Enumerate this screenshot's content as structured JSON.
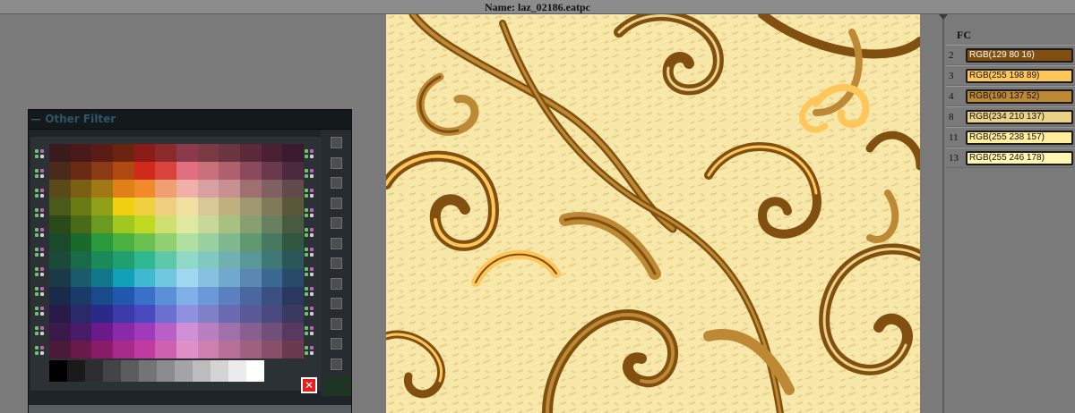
{
  "window": {
    "title": "Name: laz_02186.eatpc"
  },
  "fc_panel": {
    "title": "FC",
    "rows": [
      {
        "index": "2",
        "label": "RGB(129 80 16)",
        "color": "#815010",
        "text_color": "#ffffff"
      },
      {
        "index": "3",
        "label": "RGB(255 198 89)",
        "color": "#ffc659",
        "text_color": "#111111"
      },
      {
        "index": "4",
        "label": "RGB(190 137 52)",
        "color": "#be8934",
        "text_color": "#111111"
      },
      {
        "index": "8",
        "label": "RGB(234 210 137)",
        "color": "#ead289",
        "text_color": "#111111"
      },
      {
        "index": "11",
        "label": "RGB(255 238 157)",
        "color": "#ffee9d",
        "text_color": "#111111"
      },
      {
        "index": "13",
        "label": "RGB(255 246 178)",
        "color": "#fff6b2",
        "text_color": "#111111"
      }
    ]
  },
  "filter_panel": {
    "title": "Other Filter",
    "close_icon": "close-x-icon",
    "palette": [
      [
        "#3a1a1c",
        "#4a1a1a",
        "#5a1c14",
        "#6a2410",
        "#8a1c18",
        "#8a2a2a",
        "#8a3a4a",
        "#7a3a44",
        "#6a3440",
        "#5a2a3a",
        "#4a2034",
        "#3a1a2c"
      ],
      [
        "#4a2a1a",
        "#6a2a14",
        "#8a3a14",
        "#b04a10",
        "#d02a1a",
        "#d8443c",
        "#e07080",
        "#c8707c",
        "#b0606c",
        "#8a4a5c",
        "#6a3a4c",
        "#4a2a3c"
      ],
      [
        "#5a4a1a",
        "#7a6014",
        "#a07814",
        "#e08018",
        "#f08a2a",
        "#f0a070",
        "#f0b0a8",
        "#d8a0a0",
        "#c89090",
        "#a07070",
        "#806060",
        "#604a4a"
      ],
      [
        "#4a5a1a",
        "#6a7a14",
        "#90a018",
        "#f0d010",
        "#f0d040",
        "#f0d080",
        "#f0e0a0",
        "#d8c898",
        "#c0b080",
        "#a09870",
        "#807a5a",
        "#5a5a3a"
      ],
      [
        "#2a4a1a",
        "#4a6a1a",
        "#6a9a20",
        "#a0c820",
        "#c0d820",
        "#d0e070",
        "#e0e8a0",
        "#c8d898",
        "#a8c080",
        "#88a070",
        "#688060",
        "#485a40"
      ],
      [
        "#1a4a2a",
        "#1a6a2a",
        "#2a9a3a",
        "#4ab040",
        "#6ac050",
        "#90d070",
        "#b0e0a0",
        "#98d0a0",
        "#80b890",
        "#609870",
        "#487860",
        "#305840"
      ],
      [
        "#1a4a3a",
        "#1a6a4a",
        "#1a8a5a",
        "#20a070",
        "#30b890",
        "#60c8a8",
        "#90d8c8",
        "#80c8c0",
        "#70b0b0",
        "#589898",
        "#407878",
        "#2a5858"
      ],
      [
        "#1a3a4a",
        "#1a5a6a",
        "#10788a",
        "#10a0b8",
        "#40b8d0",
        "#70c8e0",
        "#a0d8f0",
        "#88c0e0",
        "#70a8d0",
        "#5a88b0",
        "#3a6890",
        "#2a4a6a"
      ],
      [
        "#1a2a4a",
        "#1a3a6a",
        "#1a4a8a",
        "#2058b0",
        "#3a70c8",
        "#5a90d8",
        "#80b0e8",
        "#6a98d8",
        "#5a80c0",
        "#4a68a0",
        "#3a5080",
        "#2a3860"
      ],
      [
        "#2a1a4a",
        "#2a2a6a",
        "#2a2a8a",
        "#3a3aa8",
        "#4a4ac0",
        "#6a70d0",
        "#9090e0",
        "#8080c8",
        "#6a6ab0",
        "#5a5a98",
        "#4a4a80",
        "#3a3a60"
      ],
      [
        "#3a1a4a",
        "#4a1a6a",
        "#6a1a8a",
        "#8a2aa8",
        "#a03ab8",
        "#b860c8",
        "#d090d8",
        "#b880c0",
        "#a070a8",
        "#886090",
        "#705078",
        "#583a60"
      ],
      [
        "#4a1a3a",
        "#6a1a4a",
        "#8a1a6a",
        "#a82a8a",
        "#c03aa0",
        "#d060b0",
        "#e090c8",
        "#d080b0",
        "#b87098",
        "#a06080",
        "#885068",
        "#6a3a50"
      ]
    ],
    "grayscale": [
      "#000000",
      "#1a1a1a",
      "#2e2e2e",
      "#444444",
      "#5c5c5c",
      "#747474",
      "#8c8c8c",
      "#a4a4a4",
      "#bcbcbc",
      "#d4d4d4",
      "#ececec",
      "#ffffff"
    ]
  },
  "design": {
    "name": "laz_02186",
    "colors": {
      "dark": "#815010",
      "orange": "#ffc659",
      "gold": "#be8934",
      "tan": "#ead289",
      "light": "#ffee9d",
      "pale": "#fff6b2"
    }
  }
}
